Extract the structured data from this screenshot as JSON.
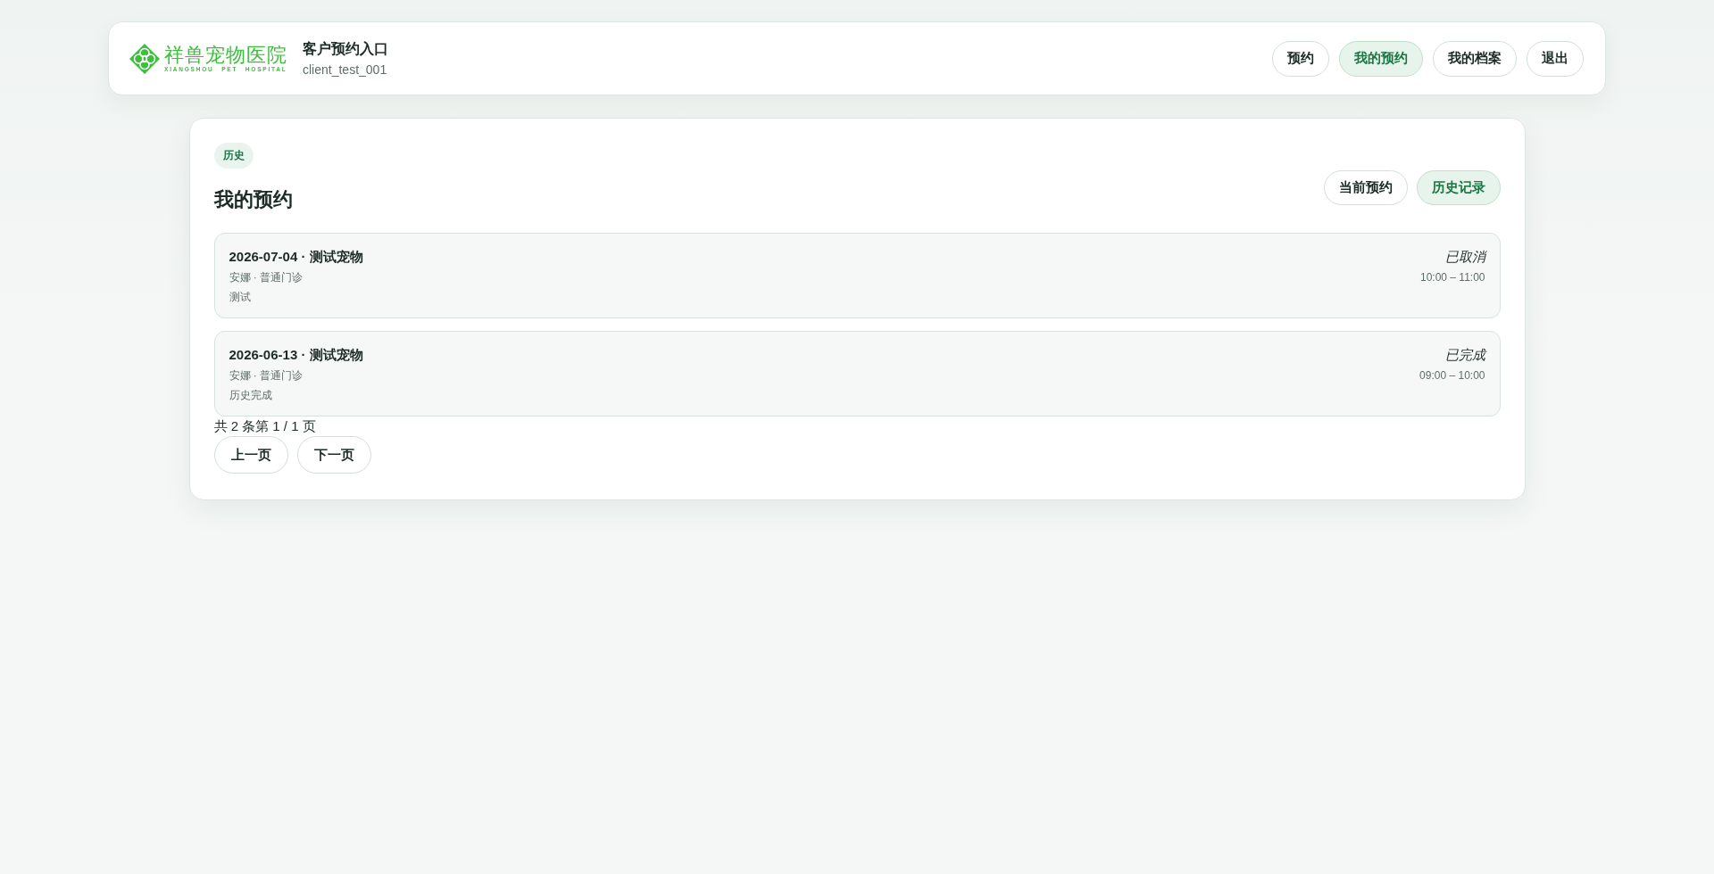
{
  "header": {
    "logo": {
      "name": "祥兽宠物医院",
      "subtitle": "XIANGSHOU PET HOSPITAL"
    },
    "title": "客户预约入口",
    "user": "client_test_001",
    "nav": [
      {
        "label": "预约",
        "selected": false
      },
      {
        "label": "我的预约",
        "selected": true
      },
      {
        "label": "我的档案",
        "selected": false
      }
    ],
    "logout": "退出"
  },
  "panel": {
    "badge": "历史",
    "title": "我的预约",
    "tabs": [
      {
        "label": "当前预约",
        "selected": false
      },
      {
        "label": "历史记录",
        "selected": true
      }
    ],
    "appointments": [
      {
        "title": "2026-07-04 · 测试宠物",
        "details": "安娜 · 普通门诊",
        "note": "测试",
        "status": "已取消",
        "time": "10:00 – 11:00"
      },
      {
        "title": "2026-06-13 · 测试宠物",
        "details": "安娜 · 普通门诊",
        "note": "历史完成",
        "status": "已完成",
        "time": "09:00 – 10:00"
      }
    ],
    "pagination": {
      "summary": "共 2 条第 1 / 1 页",
      "buttons": [
        "上一页",
        "下一页"
      ]
    }
  }
}
